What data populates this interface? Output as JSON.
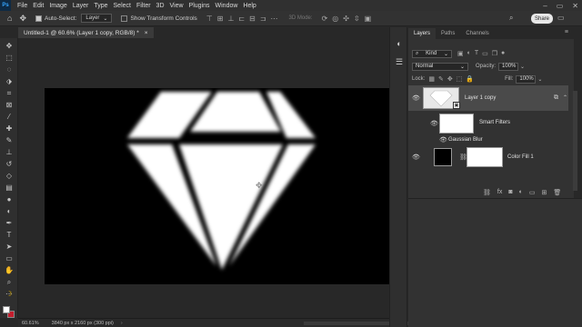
{
  "menubar": {
    "logo": "Ps",
    "items": [
      "File",
      "Edit",
      "Image",
      "Layer",
      "Type",
      "Select",
      "Filter",
      "3D",
      "View",
      "Plugins",
      "Window",
      "Help"
    ],
    "window_controls": [
      "–",
      "▭",
      "✕"
    ]
  },
  "options": {
    "auto_select_label": "Auto-Select:",
    "auto_select_target": "Layer",
    "transform_controls_label": "Show Transform Controls",
    "mode_3d_label": "3D Mode:",
    "share_label": "Share"
  },
  "document": {
    "tab_title": "Untitled-1 @ 60.6% (Layer 1 copy, RGB/8) *",
    "close_glyph": "×"
  },
  "status": {
    "zoom": "60.61%",
    "doc_info": "3840 px x 2160 px (300 ppi)",
    "arrow": "›"
  },
  "layers_panel": {
    "tabs": [
      "Layers",
      "Paths",
      "Channels"
    ],
    "menu_glyph": "≡",
    "filter_kind": "Kind",
    "blend_mode": "Normal",
    "opacity_label": "Opacity:",
    "opacity_value": "100%",
    "lock_label": "Lock:",
    "fill_label": "Fill:",
    "fill_value": "100%",
    "layers": [
      {
        "name": "Layer 1 copy",
        "selected": true
      },
      {
        "name": "Smart Filters"
      },
      {
        "name": "Gaussian Blur"
      },
      {
        "name": "Color Fill 1"
      }
    ]
  },
  "colors": {
    "foreground": "#ffffff",
    "background": "#c41e2e",
    "canvas": "#000000",
    "selected_layer": "#4a4a4a"
  }
}
